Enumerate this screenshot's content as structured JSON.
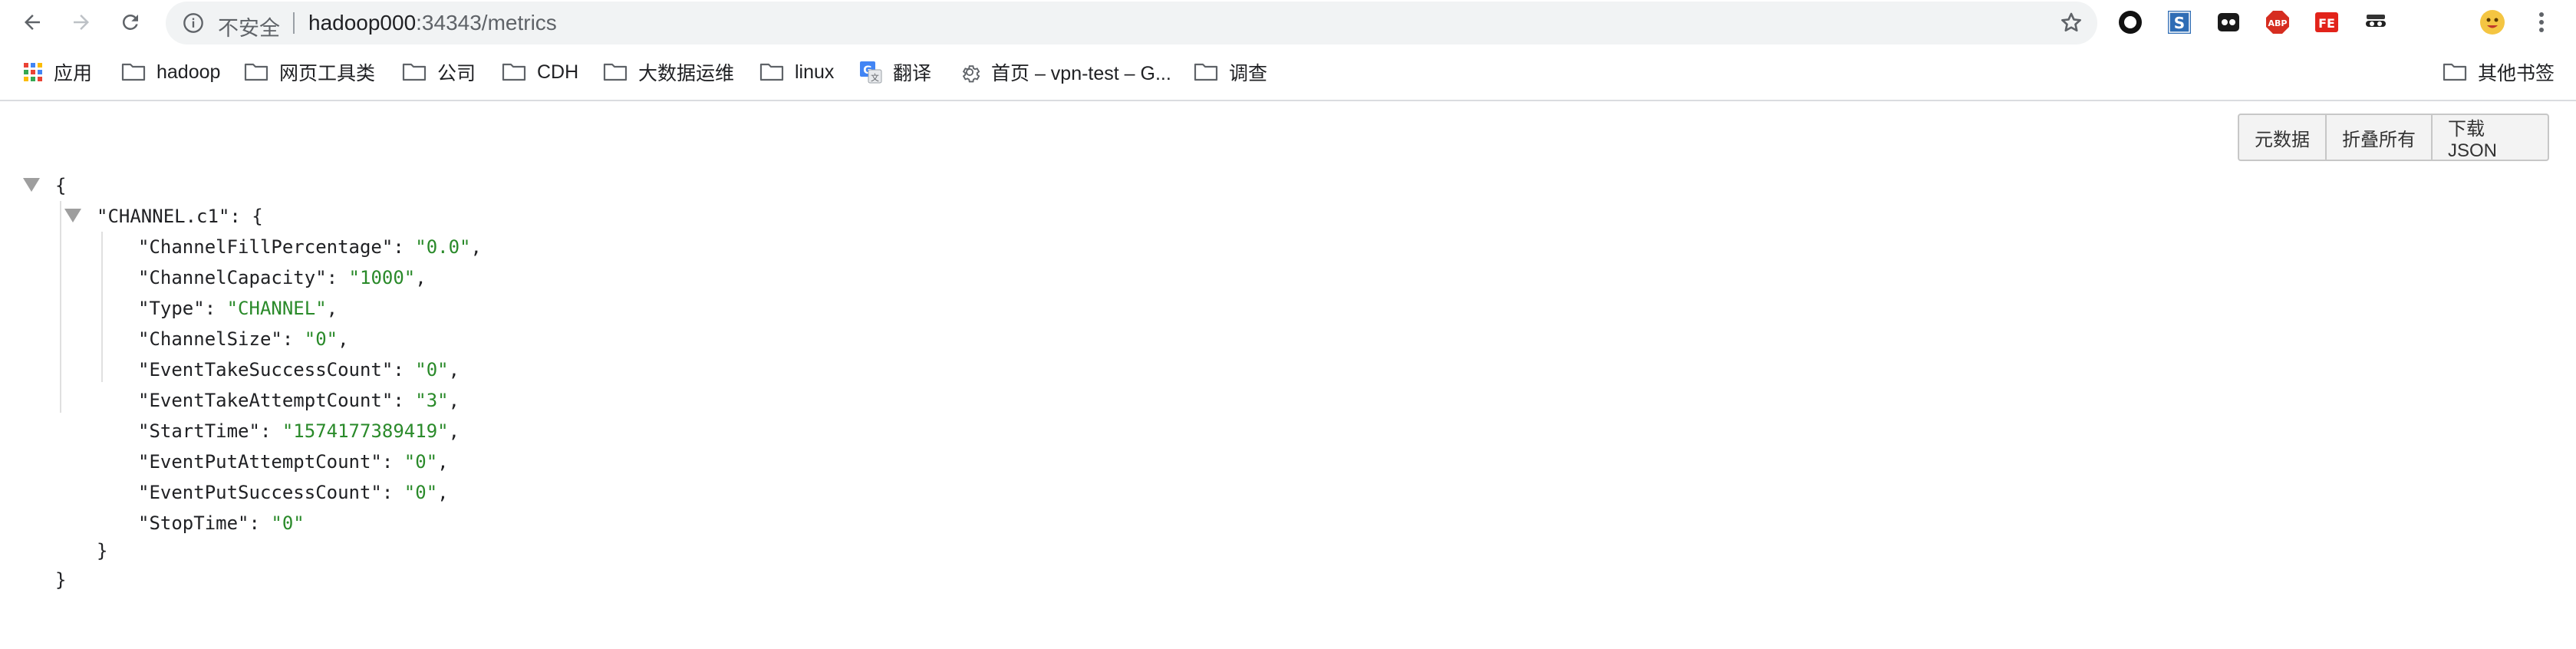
{
  "browser": {
    "security_label": "不安全",
    "url_host": "hadoop000",
    "url_path": ":34343/metrics",
    "extensions": [
      "circle-extension-icon",
      "s-extension-icon",
      "dark-reader-icon",
      "adblock-plus-icon",
      "fe-helper-icon",
      "incognito-mask-icon",
      "profile-avatar-icon",
      "menu-dots-icon"
    ]
  },
  "bookmarks": {
    "apps_label": "应用",
    "items": [
      {
        "label": "hadoop",
        "icon": "folder-icon"
      },
      {
        "label": "网页工具类",
        "icon": "folder-icon"
      },
      {
        "label": "公司",
        "icon": "folder-icon"
      },
      {
        "label": "CDH",
        "icon": "folder-icon"
      },
      {
        "label": "大数据运维",
        "icon": "folder-icon"
      },
      {
        "label": "linux",
        "icon": "folder-icon"
      },
      {
        "label": "翻译",
        "icon": "translate-icon"
      },
      {
        "label": "首页 – vpn-test – G...",
        "icon": "gear-icon"
      },
      {
        "label": "调查",
        "icon": "folder-icon"
      }
    ],
    "other_label": "其他书签"
  },
  "actions": {
    "metadata_label": "元数据",
    "collapse_label": "折叠所有",
    "download_label": "下载JSON"
  },
  "json": {
    "open_brace": "{",
    "close_brace": "}",
    "channel_key": "\"CHANNEL.c1\"",
    "channel_open": ": {",
    "channel_close": "}",
    "entries": [
      {
        "key": "\"ChannelFillPercentage\"",
        "value": "\"0.0\"",
        "comma": ","
      },
      {
        "key": "\"ChannelCapacity\"",
        "value": "\"1000\"",
        "comma": ","
      },
      {
        "key": "\"Type\"",
        "value": "\"CHANNEL\"",
        "comma": ","
      },
      {
        "key": "\"ChannelSize\"",
        "value": "\"0\"",
        "comma": ","
      },
      {
        "key": "\"EventTakeSuccessCount\"",
        "value": "\"0\"",
        "comma": ","
      },
      {
        "key": "\"EventTakeAttemptCount\"",
        "value": "\"3\"",
        "comma": ","
      },
      {
        "key": "\"StartTime\"",
        "value": "\"1574177389419\"",
        "comma": ","
      },
      {
        "key": "\"EventPutAttemptCount\"",
        "value": "\"0\"",
        "comma": ","
      },
      {
        "key": "\"EventPutSuccessCount\"",
        "value": "\"0\"",
        "comma": ","
      },
      {
        "key": "\"StopTime\"",
        "value": "\"0\"",
        "comma": ""
      }
    ],
    "colon": ": "
  }
}
